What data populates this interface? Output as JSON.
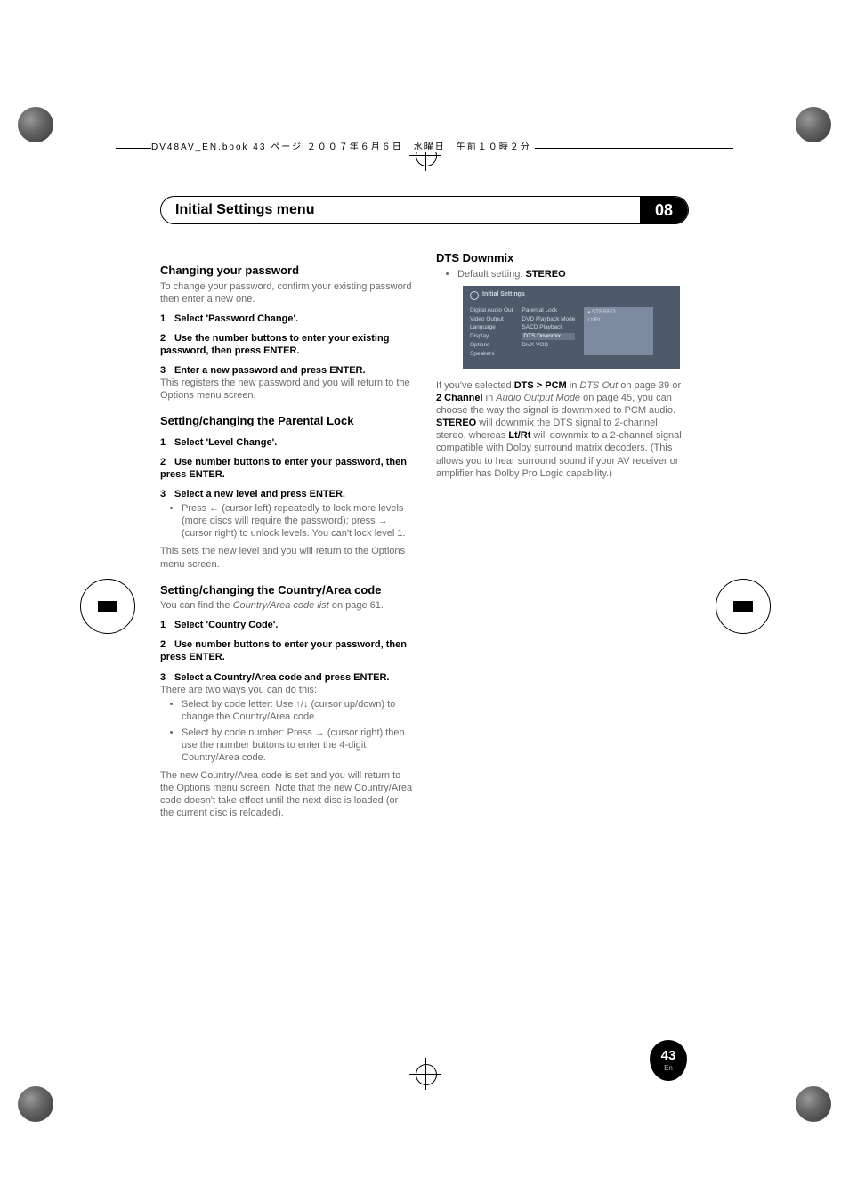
{
  "bookline": "DV48AV_EN.book  43 ページ  ２００７年６月６日　水曜日　午前１０時２分",
  "chapter": {
    "title": "Initial Settings menu",
    "number": "08"
  },
  "left": {
    "h_change_pw": "Changing your password",
    "change_pw_intro": "To change your password, confirm your existing password then enter a new one.",
    "s1_h": "Select 'Password Change'.",
    "s2_h": "Use the number buttons to enter your existing password, then press ENTER.",
    "s3_h": "Enter a new password and press ENTER.",
    "s3_body": "This registers the new password and you will return to the Options menu screen.",
    "h_parental": "Setting/changing the Parental Lock",
    "p1_h": "Select 'Level Change'.",
    "p2_h": "Use number buttons to enter your password, then press ENTER.",
    "p3_h": "Select a new level and press ENTER.",
    "p3_bullet": "Press ← (cursor left) repeatedly to lock more levels (more discs will require the password); press → (cursor right) to unlock levels. You can't lock level 1.",
    "p3_after": "This sets the new level and you will return to the Options menu screen.",
    "h_country": "Setting/changing the Country/Area code",
    "country_intro_a": "You can find the ",
    "country_intro_i": "Country/Area code list",
    "country_intro_b": " on page 61.",
    "c1_h": "Select 'Country Code'.",
    "c2_h": "Use number buttons to enter your password, then press ENTER.",
    "c3_h": "Select a Country/Area code and press ENTER.",
    "c3_after": "There are two ways you can do this:",
    "c3_b1": "Select by code letter: Use ↑/↓ (cursor up/down) to change the Country/Area code.",
    "c3_b2": "Select by code number: Press → (cursor right) then use the number buttons to enter the 4-digit Country/Area code.",
    "c_final": "The new Country/Area code is set and you will return to the Options menu screen. Note that the new Country/Area code doesn't take effect until the next disc is loaded (or the current disc is reloaded)."
  },
  "right": {
    "h_dts": "DTS Downmix",
    "dts_default_a": "Default setting: ",
    "dts_default_b": "STEREO",
    "panel": {
      "header": "Initial Settings",
      "c1": [
        "Digital Audio Out",
        "Video Output",
        "Language",
        "Display",
        "Options",
        "Speakers"
      ],
      "c2": [
        "Parental Lock",
        "DVD Playback Mode",
        "SACD Playback",
        "DTS Downmix",
        "DivX VOD"
      ],
      "c3": [
        "STEREO",
        "Lt/Rt"
      ]
    },
    "dts_body_1": "If you've selected ",
    "dts_body_2": "DTS > PCM",
    "dts_body_3": " in ",
    "dts_body_4": "DTS Out",
    "dts_body_5": " on page 39 or ",
    "dts_body_6": "2 Channel",
    "dts_body_7": " in ",
    "dts_body_8": "Audio Output Mode",
    "dts_body_9": " on page 45, you can choose the way the signal is downmixed to PCM audio. ",
    "dts_body_10": "STEREO",
    "dts_body_11": " will downmix the DTS signal to 2-channel stereo, whereas ",
    "dts_body_12": "Lt/Rt",
    "dts_body_13": " will downmix to a 2-channel signal compatible with Dolby surround matrix decoders. (This allows you to hear surround sound if your AV receiver or amplifier has Dolby Pro Logic capability.)"
  },
  "page_badge": {
    "num": "43",
    "lang": "En"
  }
}
